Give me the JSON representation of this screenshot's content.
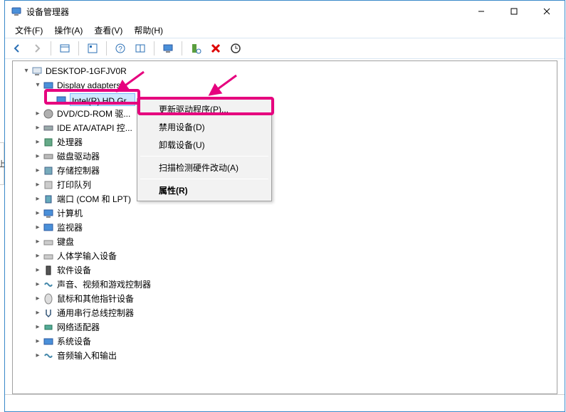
{
  "window": {
    "title": "设备管理器",
    "controls": {
      "minimize": "–",
      "maximize": "☐",
      "close": "✕"
    }
  },
  "menubar": {
    "file": "文件(F)",
    "action": "操作(A)",
    "view": "查看(V)",
    "help": "帮助(H)"
  },
  "toolbar_icons": {
    "back": "back-arrow",
    "forward": "forward-arrow",
    "show_hidden": "show-hidden",
    "properties": "properties",
    "help": "help",
    "details": "details",
    "computer": "computer",
    "scan": "scan",
    "remove": "remove",
    "update": "update"
  },
  "tree": {
    "root": "DESKTOP-1GFJV0R",
    "expanded_category": "Display adapters",
    "selected_device": "Intel(R) HD Gr...",
    "items": [
      "DVD/CD-ROM 驱...",
      "IDE ATA/ATAPI 控...",
      "处理器",
      "磁盘驱动器",
      "存储控制器",
      "打印队列",
      "端口 (COM 和 LPT)",
      "计算机",
      "监视器",
      "键盘",
      "人体学输入设备",
      "软件设备",
      "声音、视频和游戏控制器",
      "鼠标和其他指针设备",
      "通用串行总线控制器",
      "网络适配器",
      "系统设备",
      "音频输入和输出"
    ]
  },
  "context_menu": {
    "update_driver": "更新驱动程序(P)...",
    "disable": "禁用设备(D)",
    "uninstall": "卸载设备(U)",
    "scan_changes": "扫描检测硬件改动(A)",
    "properties": "属性(R)"
  },
  "edge_text": "上"
}
